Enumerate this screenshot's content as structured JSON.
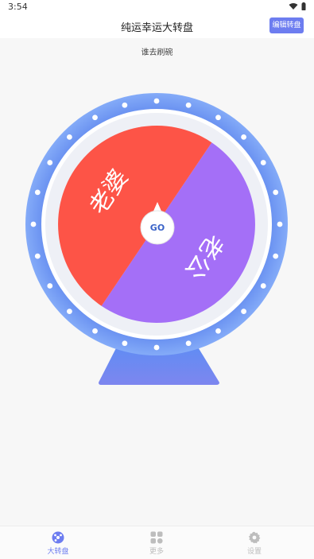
{
  "status_bar": {
    "time": "3:54",
    "wifi_icon": "wifi-icon",
    "battery_icon": "battery-icon"
  },
  "app_bar": {
    "title": "纯运幸运大转盘",
    "edit_button_label": "编辑转盘"
  },
  "wheel": {
    "title": "谁去刷碗",
    "center_label": "GO",
    "segments": [
      {
        "label": "老公",
        "color": "#a46ff7"
      },
      {
        "label": "老婆",
        "color": "#fd5447"
      }
    ],
    "colors": {
      "rim": "#6b8ff0",
      "rim_light": "#7fa8f8",
      "inner_ring": "#ffffff",
      "dots": "#ffffff",
      "center_text": "#3a63c8"
    }
  },
  "bottom_nav": {
    "items": [
      {
        "label": "大转盘",
        "icon": "wheel-icon",
        "active": true
      },
      {
        "label": "更多",
        "icon": "grid-icon",
        "active": false
      },
      {
        "label": "设置",
        "icon": "gear-icon",
        "active": false
      }
    ],
    "active_color": "#6d7df0",
    "inactive_color": "#bdbdbd"
  }
}
